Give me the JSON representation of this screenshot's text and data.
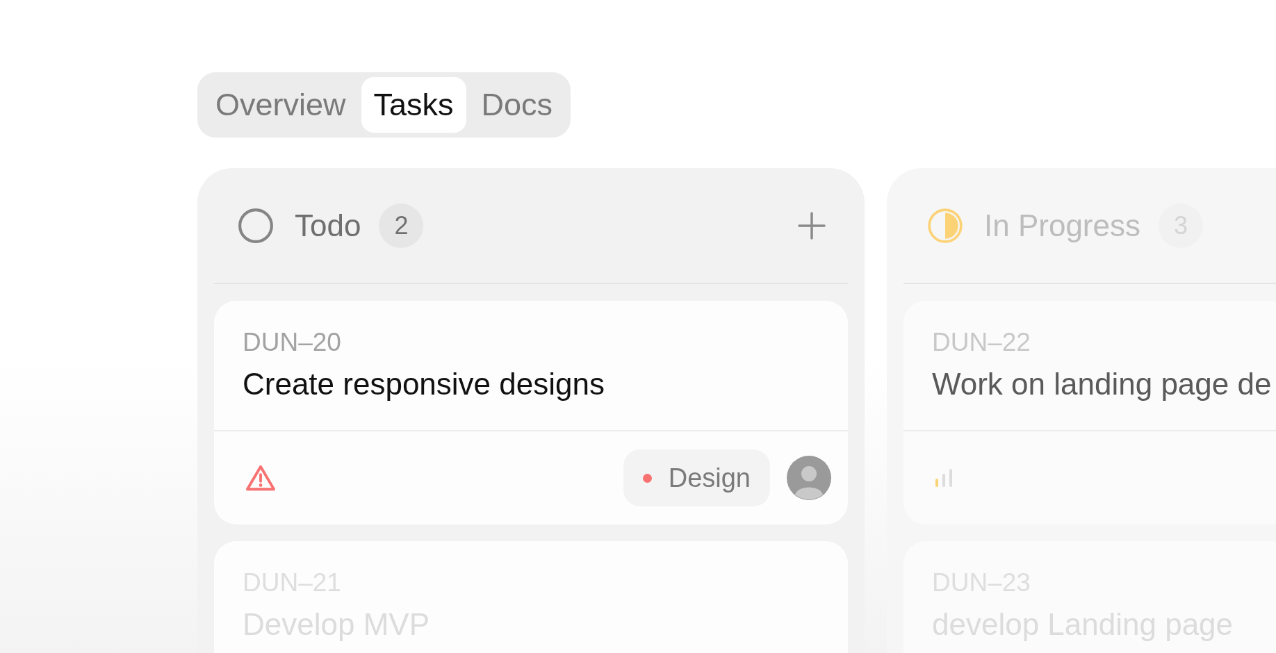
{
  "tabs": [
    {
      "label": "Overview",
      "selected": false
    },
    {
      "label": "Tasks",
      "selected": true
    },
    {
      "label": "Docs",
      "selected": false
    }
  ],
  "columns": [
    {
      "kind": "todo",
      "title": "Todo",
      "count": "2",
      "add_button": true,
      "cards": [
        {
          "id": "DUN–20",
          "title": "Create responsive designs",
          "priority": {
            "kind": "urgent"
          },
          "tag": {
            "label": "Design",
            "color": "#f87171"
          },
          "has_avatar": true
        },
        {
          "id": "DUN–21",
          "title": "Develop MVP"
        }
      ]
    },
    {
      "kind": "in_progress",
      "title": "In Progress",
      "count": "3",
      "add_button": false,
      "cards": [
        {
          "id": "DUN–22",
          "title": "Work on landing page de",
          "priority": {
            "kind": "low"
          }
        },
        {
          "id": "DUN–23",
          "title": "develop Landing page"
        }
      ]
    }
  ]
}
